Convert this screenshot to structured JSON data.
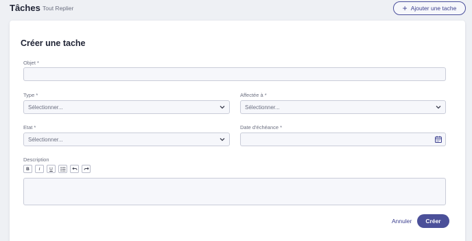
{
  "header": {
    "title": "Tâches",
    "collapse_label": "Tout Replier",
    "add_task_label": "Ajouter une tache"
  },
  "form": {
    "title": "Créer une tache",
    "fields": {
      "objet": {
        "label": "Objet *",
        "value": ""
      },
      "type": {
        "label": "Type *",
        "value": "Sélectionner..."
      },
      "assigned": {
        "label": "Affectée à *",
        "value": "Sélectionner..."
      },
      "state": {
        "label": "Etat *",
        "value": "Sélectionner..."
      },
      "due_date": {
        "label": "Date d'échéance *",
        "value": ""
      },
      "description": {
        "label": "Description",
        "value": ""
      }
    },
    "toolbar": {
      "bold": "B",
      "italic": "I",
      "underline": "U"
    },
    "cancel_label": "Annuler",
    "submit_label": "Créer"
  }
}
